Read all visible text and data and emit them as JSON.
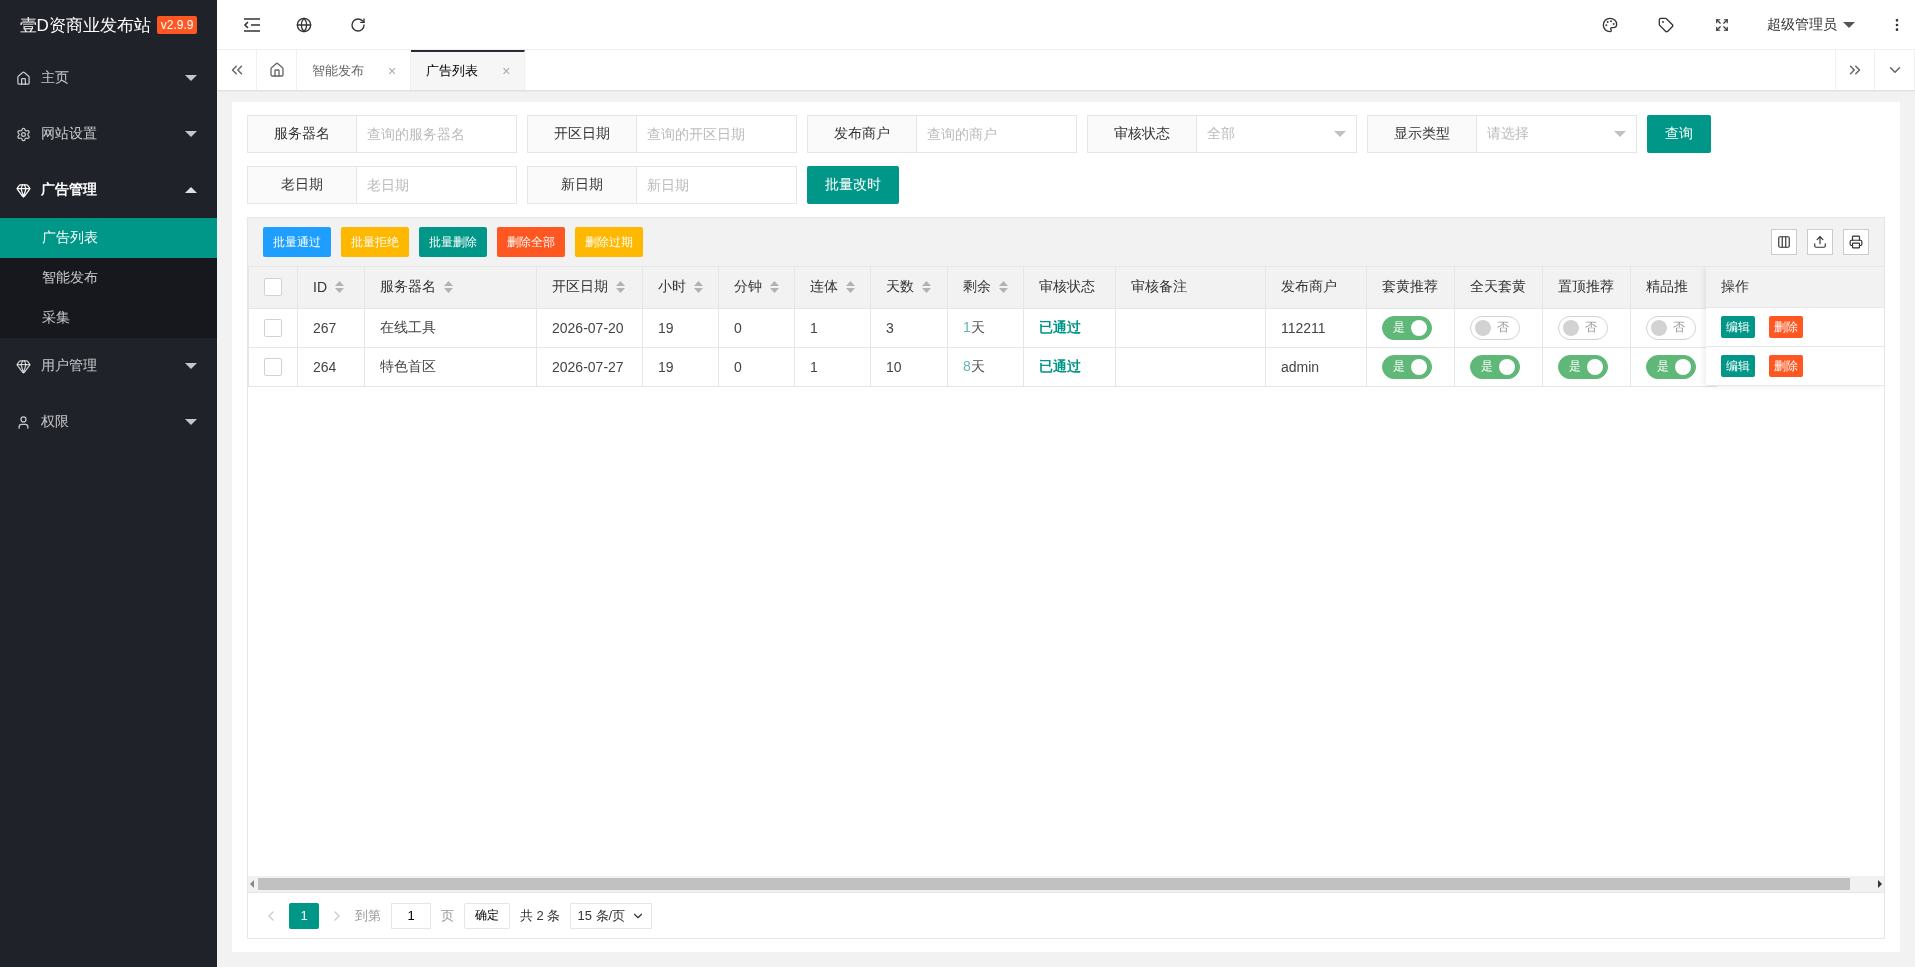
{
  "brand": {
    "title": "壹D资商业发布站",
    "version": "v2.9.9"
  },
  "sidebar": {
    "items": [
      {
        "label": "主页",
        "expanded": false
      },
      {
        "label": "网站设置",
        "expanded": false
      },
      {
        "label": "广告管理",
        "expanded": true,
        "children": [
          {
            "label": "广告列表",
            "selected": true
          },
          {
            "label": "智能发布",
            "selected": false
          },
          {
            "label": "采集",
            "selected": false
          }
        ]
      },
      {
        "label": "用户管理",
        "expanded": false
      },
      {
        "label": "权限",
        "expanded": false
      }
    ]
  },
  "header": {
    "user": "超级管理员"
  },
  "tabs": [
    {
      "label": "智能发布",
      "selected": false,
      "close": "×"
    },
    {
      "label": "广告列表",
      "selected": true,
      "close": "×"
    }
  ],
  "filters": [
    {
      "kind": "input",
      "label": "服务器名",
      "placeholder": "查询的服务器名"
    },
    {
      "kind": "input",
      "label": "开区日期",
      "placeholder": "查询的开区日期"
    },
    {
      "kind": "input",
      "label": "发布商户",
      "placeholder": "查询的商户"
    },
    {
      "kind": "select",
      "label": "审核状态",
      "placeholder": "全部"
    },
    {
      "kind": "select",
      "label": "显示类型",
      "placeholder": "请选择"
    },
    {
      "kind": "button",
      "label": "查询"
    },
    {
      "kind": "break"
    },
    {
      "kind": "input",
      "label": "老日期",
      "placeholder": "老日期"
    },
    {
      "kind": "input",
      "label": "新日期",
      "placeholder": "新日期"
    },
    {
      "kind": "button",
      "label": "批量改时"
    }
  ],
  "toolbar": [
    {
      "label": "批量通过",
      "color": "#1e9fff"
    },
    {
      "label": "批量拒绝",
      "color": "#ffb800"
    },
    {
      "label": "批量删除",
      "color": "#009688"
    },
    {
      "label": "删除全部",
      "color": "#ff5722"
    },
    {
      "label": "删除过期",
      "color": "#ffb800"
    }
  ],
  "table": {
    "select_all_checked": false,
    "columns": [
      {
        "label": "ID",
        "sortable": true
      },
      {
        "label": "服务器名",
        "sortable": true
      },
      {
        "label": "开区日期",
        "sortable": true
      },
      {
        "label": "小时",
        "sortable": true
      },
      {
        "label": "分钟",
        "sortable": true
      },
      {
        "label": "连体",
        "sortable": true
      },
      {
        "label": "天数",
        "sortable": true
      },
      {
        "label": "剩余",
        "sortable": true
      },
      {
        "label": "审核状态",
        "sortable": false
      },
      {
        "label": "审核备注",
        "sortable": false
      },
      {
        "label": "发布商户",
        "sortable": false
      },
      {
        "label": "套黄推荐",
        "sortable": false
      },
      {
        "label": "全天套黄",
        "sortable": false
      },
      {
        "label": "置顶推荐",
        "sortable": false
      },
      {
        "label": "精品推",
        "sortable": false
      }
    ],
    "action_column": "操作",
    "rows": [
      {
        "checked": false,
        "id": "267",
        "server": "在线工具",
        "date": "2026-07-20",
        "hour": "19",
        "minute": "0",
        "linked": "1",
        "days": "3",
        "remaining": "1",
        "remaining_unit": "天",
        "status": "已通过",
        "merchant": "112211",
        "toggles": [
          {
            "on": true,
            "label": "是"
          },
          {
            "on": false,
            "label": "否"
          },
          {
            "on": false,
            "label": "否"
          },
          {
            "on": false,
            "label": "否"
          }
        ],
        "actions": [
          {
            "label": "编辑",
            "color": "#009688"
          },
          {
            "label": "删除",
            "color": "#ff5722"
          }
        ]
      },
      {
        "checked": false,
        "id": "264",
        "server": "特色首区",
        "date": "2026-07-27",
        "hour": "19",
        "minute": "0",
        "linked": "1",
        "days": "10",
        "remaining": "8",
        "remaining_unit": "天",
        "status": "已通过",
        "merchant": "admin",
        "toggles": [
          {
            "on": true,
            "label": "是"
          },
          {
            "on": true,
            "label": "是"
          },
          {
            "on": true,
            "label": "是"
          },
          {
            "on": true,
            "label": "是"
          }
        ],
        "actions": [
          {
            "label": "编辑",
            "color": "#009688"
          },
          {
            "label": "删除",
            "color": "#ff5722"
          }
        ]
      }
    ]
  },
  "pagination": {
    "current": "1",
    "goto_label": "到第",
    "goto_value": "1",
    "page_unit": "页",
    "confirm": "确定",
    "total": "共 2 条",
    "page_size": "15 条/页"
  }
}
